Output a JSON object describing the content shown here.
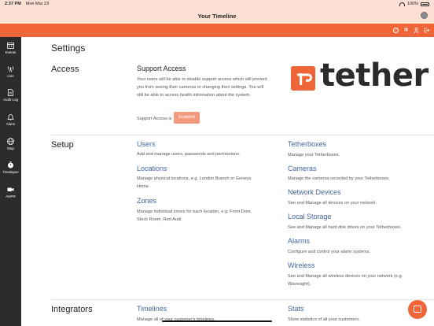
{
  "status_bar": {
    "time": "2:37 PM",
    "date": "Mon Mar 23",
    "battery": "100%"
  },
  "window": {
    "title": "Your Timeline"
  },
  "toolbar": {
    "icons": [
      "help-icon",
      "gear-icon",
      "user-icon",
      "logout-icon"
    ]
  },
  "sidebar": {
    "items": [
      {
        "label": "Events",
        "icon": "calendar-icon"
      },
      {
        "label": "Live",
        "icon": "broadcast-icon"
      },
      {
        "label": "Audit Log",
        "icon": "document-icon"
      },
      {
        "label": "Alarm",
        "icon": "bell-icon"
      },
      {
        "label": "Map",
        "icon": "globe-icon"
      },
      {
        "label": "Timelapse",
        "icon": "stopwatch-icon"
      },
      {
        "label": "ANPR",
        "icon": "camera-icon"
      }
    ]
  },
  "main": {
    "page_title": "Settings",
    "access": {
      "section": "Access",
      "title": "Support Access",
      "description": "Your users will be able to disable support access which will prevent you from seeing their cameras or changing their settings. You will still be able to access health information about the system.",
      "status_label": "Support Access is",
      "status_value": "Enabled"
    },
    "logo": {
      "text": "tether"
    },
    "setup": {
      "section": "Setup",
      "col1": [
        {
          "title": "Users",
          "desc": "Add and manage users, passwords and permissions."
        },
        {
          "title": "Locations",
          "desc": "Manage physical locations, e.g. London Branch or Geneva Home."
        },
        {
          "title": "Zones",
          "desc": "Manage individual zones for each location, e.g. Front Door, Stock Room, Red Audi."
        }
      ],
      "col2": [
        {
          "title": "Tetherboxes",
          "desc": "Manage your Tetherboxes."
        },
        {
          "title": "Cameras",
          "desc": "Manage the cameras recorded by your Tetherboxes."
        },
        {
          "title": "Network Devices",
          "desc": "See and Manage all devices on your network."
        },
        {
          "title": "Local Storage",
          "desc": "See and Manage all hard disk drives on your Tetherboxes."
        },
        {
          "title": "Alarms",
          "desc": "Configure and control your alarm systems."
        },
        {
          "title": "Wireless",
          "desc": "See and Manage all wireless devices on your network (e.g. Wavesight)."
        }
      ]
    },
    "integrators": {
      "section": "Integrators",
      "col1": [
        {
          "title": "Timelines",
          "desc": "Manage all of your customer's timelines."
        }
      ],
      "col2": [
        {
          "title": "Stats",
          "desc": "Show statistics of all your customers."
        }
      ]
    }
  },
  "colors": {
    "accent": "#ef6537",
    "link": "#44669e",
    "sidebar": "#2b2b2b",
    "header": "#fde0d4"
  }
}
